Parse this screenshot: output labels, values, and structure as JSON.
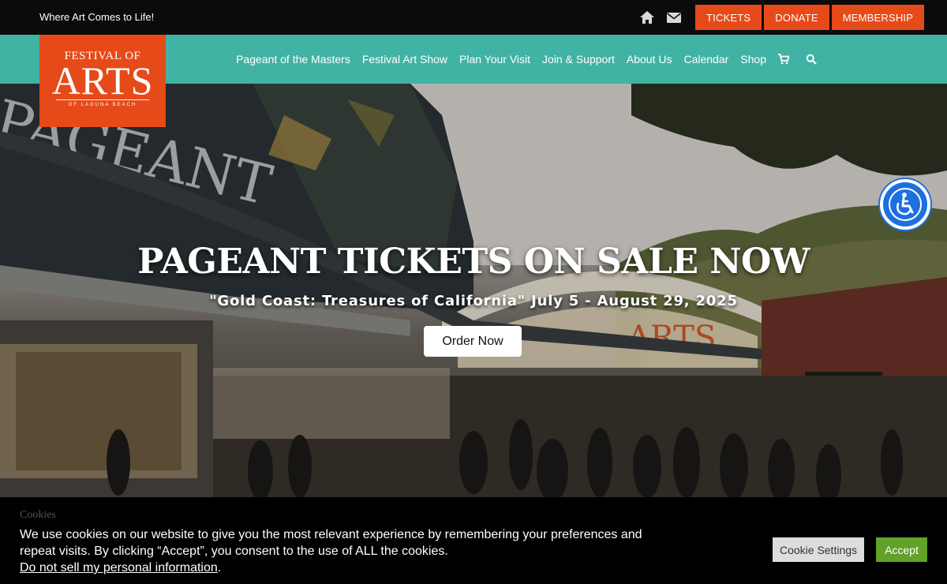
{
  "topbar": {
    "tagline": "Where Art Comes to Life!",
    "icons": [
      "home-icon",
      "envelope-icon"
    ],
    "buttons": [
      "TICKETS",
      "DONATE",
      "MEMBERSHIP"
    ]
  },
  "logo": {
    "top": "FESTIVAL OF",
    "main": "ARTS",
    "sub": "OF LAGUNA BEACH"
  },
  "nav": {
    "items": [
      "Pageant of the Masters",
      "Festival Art Show",
      "Plan Your Visit",
      "Join & Support",
      "About Us",
      "Calendar",
      "Shop"
    ],
    "icons": [
      "cart-icon",
      "search-icon"
    ]
  },
  "hero": {
    "title": "PAGEANT TICKETS ON SALE NOW",
    "subtitle": "\"Gold Coast: Treasures of California\" July 5 - August 29, 2025",
    "button": "Order Now"
  },
  "cookie": {
    "title": "Cookies",
    "text": "We use cookies on our website to give you the most relevant experience by remembering your preferences and repeat visits. By clicking “Accept”, you consent to the use of ALL the cookies.",
    "link": "Do not sell my personal information",
    "settings_label": "Cookie Settings",
    "accept_label": "Accept"
  },
  "colors": {
    "brand_orange": "#e64a19",
    "nav_teal": "#40b3a5",
    "accept_green": "#61a229",
    "accessibility_blue": "#1e6fe0"
  }
}
